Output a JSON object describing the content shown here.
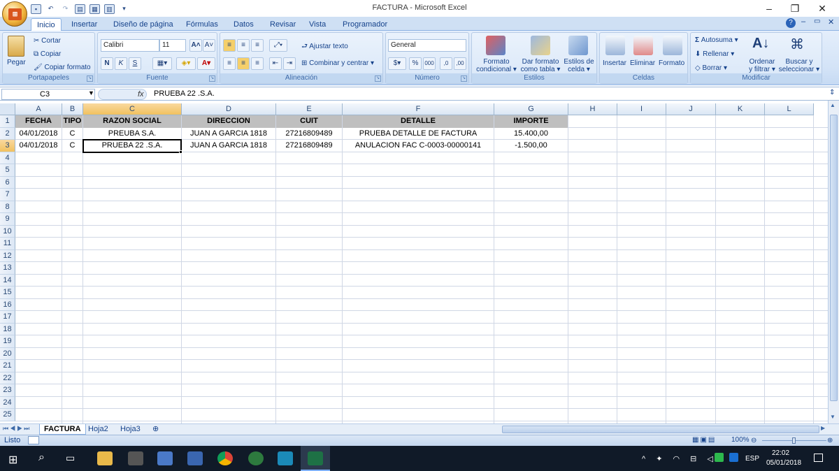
{
  "window": {
    "title": "FACTURA - Microsoft Excel"
  },
  "tabs": [
    "Inicio",
    "Insertar",
    "Diseño de página",
    "Fórmulas",
    "Datos",
    "Revisar",
    "Vista",
    "Programador"
  ],
  "ribbon": {
    "portapapeles": {
      "label": "Portapapeles",
      "pegar": "Pegar",
      "cortar": "Cortar",
      "copiar": "Copiar",
      "copiar_formato": "Copiar formato"
    },
    "fuente": {
      "label": "Fuente",
      "font": "Calibri",
      "size": "11"
    },
    "alineacion": {
      "label": "Alineación",
      "ajustar": "Ajustar texto",
      "combinar": "Combinar y centrar"
    },
    "numero": {
      "label": "Número",
      "format": "General"
    },
    "estilos": {
      "label": "Estilos",
      "formato_cond_1": "Formato",
      "formato_cond_2": "condicional",
      "dar_formato_1": "Dar formato",
      "dar_formato_2": "como tabla",
      "estilos_celda_1": "Estilos de",
      "estilos_celda_2": "celda"
    },
    "celdas": {
      "label": "Celdas",
      "insertar": "Insertar",
      "eliminar": "Eliminar",
      "formato": "Formato"
    },
    "modificar": {
      "label": "Modificar",
      "autosuma": "Autosuma",
      "rellenar": "Rellenar",
      "borrar": "Borrar",
      "ordenar_1": "Ordenar",
      "ordenar_2": "y filtrar",
      "buscar_1": "Buscar y",
      "buscar_2": "seleccionar"
    }
  },
  "formula_bar": {
    "name_box": "C3",
    "fx": "fx",
    "value": "PRUEBA 22 .S.A."
  },
  "columns": [
    "A",
    "B",
    "C",
    "D",
    "E",
    "F",
    "G",
    "H",
    "I",
    "J",
    "K",
    "L"
  ],
  "rows": [
    "1",
    "2",
    "3",
    "4",
    "5",
    "6",
    "7",
    "8",
    "9",
    "10",
    "11",
    "12",
    "13",
    "14",
    "15",
    "16",
    "17",
    "18",
    "19",
    "20",
    "21",
    "22",
    "23",
    "24",
    "25"
  ],
  "table": {
    "headers": [
      "FECHA",
      "TIPO",
      "RAZON SOCIAL",
      "DIRECCION",
      "CUIT",
      "DETALLE",
      "IMPORTE"
    ],
    "data": [
      [
        "04/01/2018",
        "C",
        "PREUBA S.A.",
        "JUAN A GARCIA 1818",
        "27216809489",
        "PRUEBA DETALLE DE FACTURA",
        "15.400,00"
      ],
      [
        "04/01/2018",
        "C",
        "PRUEBA 22 .S.A.",
        "JUAN A GARCIA 1818",
        "27216809489",
        "ANULACION FAC C-0003-00000141",
        "-1.500,00"
      ]
    ]
  },
  "sheets": [
    "FACTURA",
    "Hoja2",
    "Hoja3"
  ],
  "status": {
    "mode": "Listo",
    "zoom": "100%"
  },
  "taskbar": {
    "time": "22:02",
    "date": "05/01/2018",
    "lang": "ESP"
  },
  "colors": {
    "ribbon": "#d3e3f7",
    "header_fill": "#bfbfbf",
    "taskbar": "#101a28"
  }
}
